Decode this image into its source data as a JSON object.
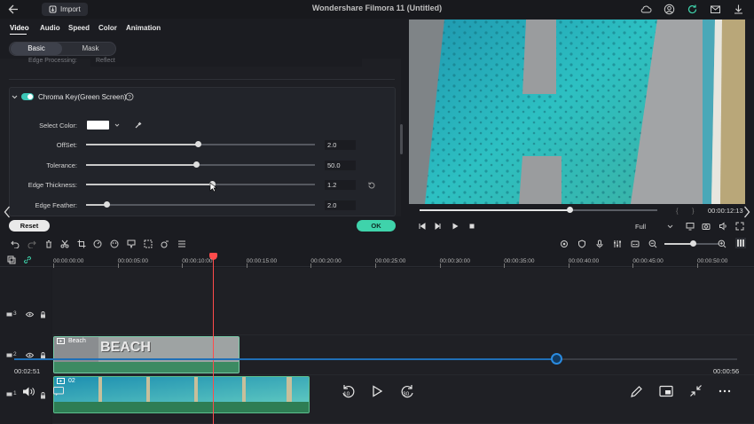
{
  "app": {
    "title": "Wondershare Filmora 11 (Untitled)",
    "import_label": "Import"
  },
  "tabs": [
    {
      "label": "Video",
      "active": true
    },
    {
      "label": "Audio",
      "active": false
    },
    {
      "label": "Speed",
      "active": false
    },
    {
      "label": "Color",
      "active": false
    },
    {
      "label": "Animation",
      "active": false
    }
  ],
  "segment": {
    "basic": "Basic",
    "mask": "Mask"
  },
  "prev_section": {
    "label": "Edge Processing:",
    "value": "Reflect"
  },
  "chroma": {
    "title": "Chroma Key(Green Screen)",
    "enabled": true,
    "select_color_label": "Select Color:",
    "select_color_value": "#ffffff",
    "rows": [
      {
        "label": "OffSet:",
        "value": "2.0",
        "fraction": 0.49
      },
      {
        "label": "Tolerance:",
        "value": "50.0",
        "fraction": 0.48
      },
      {
        "label": "Edge Thickness:",
        "value": "1.2",
        "fraction": 0.55
      },
      {
        "label": "Edge Feather:",
        "value": "2.0",
        "fraction": 0.09
      }
    ]
  },
  "buttons": {
    "reset": "Reset",
    "ok": "OK"
  },
  "player": {
    "time": "00:00:12:13",
    "progress": 0.63,
    "quality": "Full"
  },
  "ruler": {
    "labels": [
      "00:00:00:00",
      "00:00:05:00",
      "00:00:10:00",
      "00:00:15:00",
      "00:00:20:00",
      "00:00:25:00",
      "00:00:30:00",
      "00:00:35:00",
      "00:00:40:00",
      "00:00:45:00",
      "00:00:50:00"
    ]
  },
  "tracks": [
    {
      "num": "3"
    },
    {
      "num": "2",
      "clip": "Beach",
      "clip_text": "BEACH"
    },
    {
      "num": "1",
      "clip": "02"
    }
  ],
  "mini_player": {
    "current": "00:02:51",
    "total": "00:00:56",
    "progress": 0.75,
    "rewind": "10",
    "forward": "30"
  },
  "colors": {
    "accent": "#3fd3ab",
    "playhead": "#ff4b4b",
    "mini_progress": "#2a8be0"
  }
}
